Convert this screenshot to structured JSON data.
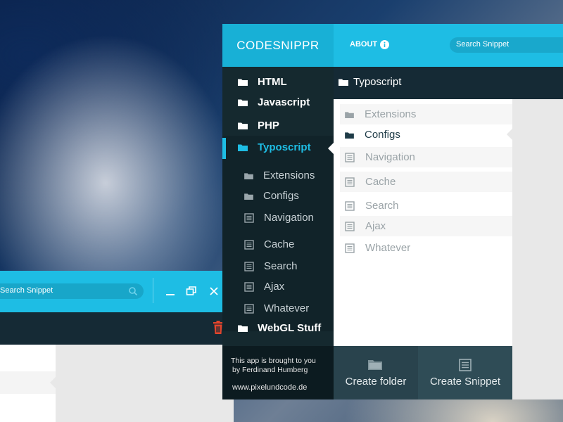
{
  "background_window": {
    "search_placeholder": "Search Snippet"
  },
  "app": {
    "logo": "CODESNIPPR",
    "about_label": "ABOUT",
    "search_placeholder": "Search Snippet",
    "current_path": "Typoscript"
  },
  "sidebar": {
    "items": [
      {
        "label": "HTML",
        "icon": "folder-icon"
      },
      {
        "label": "Javascript",
        "icon": "folder-icon"
      },
      {
        "label": "PHP",
        "icon": "folder-icon"
      },
      {
        "label": "Typoscript",
        "icon": "folder-icon",
        "active": true
      }
    ],
    "sub_items": [
      {
        "label": "Extensions",
        "icon": "folder-icon"
      },
      {
        "label": "Configs",
        "icon": "folder-icon"
      },
      {
        "label": "Navigation",
        "icon": "document-icon"
      },
      {
        "label": "Cache",
        "icon": "document-icon"
      },
      {
        "label": "Search",
        "icon": "document-icon"
      },
      {
        "label": "Ajax",
        "icon": "document-icon"
      },
      {
        "label": "Whatever",
        "icon": "document-icon"
      }
    ],
    "last_item": {
      "label": "WebGL Stuff",
      "icon": "folder-icon"
    },
    "credits": {
      "line1": "This app is brought to you",
      "line2": "by Ferdinand Humberg",
      "line3": "www.pixelundcode.de"
    }
  },
  "list": {
    "items": [
      {
        "label": "Extensions",
        "icon": "folder-icon"
      },
      {
        "label": "Configs",
        "icon": "folder-icon",
        "selected": true
      },
      {
        "label": "Navigation",
        "icon": "document-icon"
      },
      {
        "label": "Cache",
        "icon": "document-icon"
      },
      {
        "label": "Search",
        "icon": "document-icon"
      },
      {
        "label": "Ajax",
        "icon": "document-icon"
      },
      {
        "label": "Whatever",
        "icon": "document-icon"
      }
    ]
  },
  "actions": {
    "create_folder": "Create folder",
    "create_snippet": "Create Snippet"
  },
  "colors": {
    "accent": "#1ebde4",
    "sidebar": "#15292f",
    "delete": "#e2452c"
  }
}
